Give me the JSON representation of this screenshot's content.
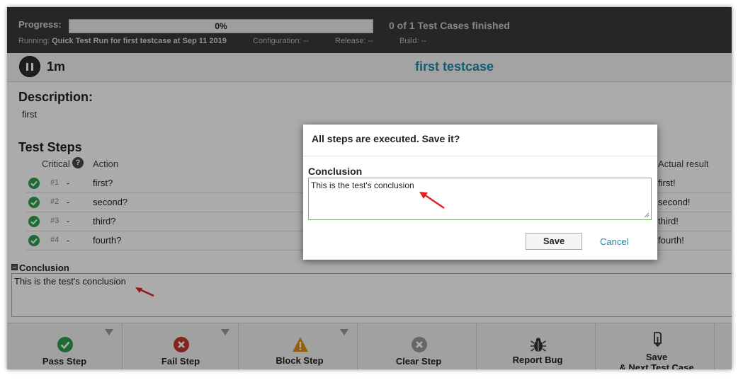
{
  "progress": {
    "label": "Progress:",
    "percent_text": "0%",
    "fraction": 0,
    "status": "0 of 1 Test Cases finished"
  },
  "run_meta": {
    "running_label": "Running:",
    "running_value": "Quick Test Run for first testcase at Sep 11 2019",
    "configuration": "Configuration: --",
    "release": "Release: --",
    "build": "Build: --"
  },
  "header": {
    "timer": "1m",
    "testcase_title": "first testcase"
  },
  "description": {
    "heading": "Description:",
    "text": "first"
  },
  "steps": {
    "heading": "Test Steps",
    "col_critical": "Critical",
    "col_action": "Action",
    "col_actual": "Actual result",
    "help_glyph": "?",
    "rows": [
      {
        "num": "#1",
        "dash": "-",
        "action": "first?",
        "actual": "first!"
      },
      {
        "num": "#2",
        "dash": "-",
        "action": "second?",
        "actual": "second!"
      },
      {
        "num": "#3",
        "dash": "-",
        "action": "third?",
        "actual": "third!"
      },
      {
        "num": "#4",
        "dash": "-",
        "action": "fourth?",
        "actual": "fourth!"
      }
    ]
  },
  "conclusion": {
    "heading": "Conclusion",
    "text": "This is the test's conclusion"
  },
  "toolbar": {
    "pass": "Pass Step",
    "fail": "Fail Step",
    "block": "Block Step",
    "clear": "Clear Step",
    "report": "Report Bug",
    "save_next_1": "Save",
    "save_next_2": "& Next Test Case"
  },
  "modal": {
    "title": "All steps are executed. Save it?",
    "label": "Conclusion",
    "text": "This is the test's conclusion",
    "save": "Save",
    "cancel": "Cancel"
  },
  "colors": {
    "accent": "#1e88a8",
    "pass": "#2e9e4e",
    "fail": "#c0392b",
    "block": "#e08e0b",
    "arrow": "#e52222"
  }
}
